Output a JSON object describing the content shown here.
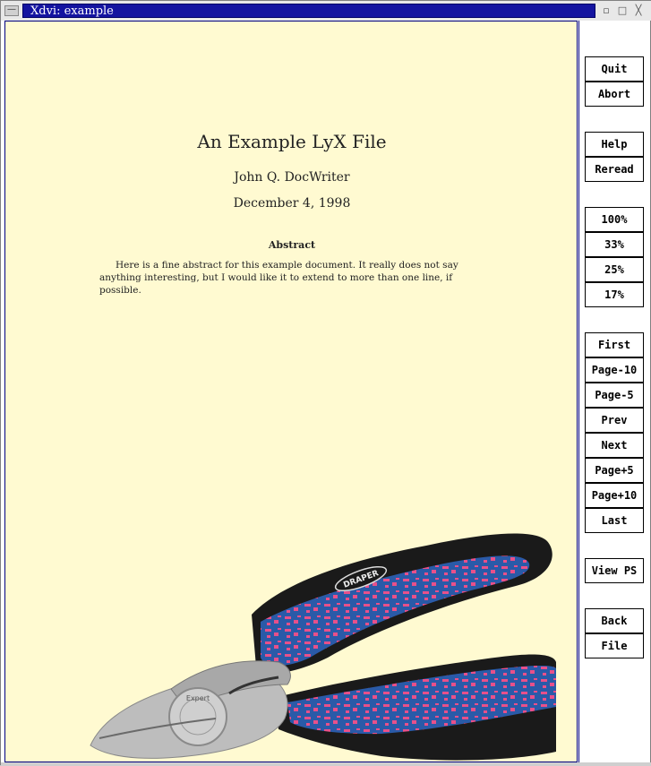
{
  "window": {
    "title": "Xdvi:  example",
    "menu_glyph": "—",
    "minimize_glyph": "▫",
    "maximize_glyph": "□",
    "close_glyph": "╳"
  },
  "document": {
    "title": "An Example LyX File",
    "author": "John Q. DocWriter",
    "date": "December 4, 1998",
    "abstract_heading": "Abstract",
    "abstract_text": "Here is a fine abstract for this example document. It really does not say anything interesting, but I would like it to extend to more than one line, if possible.",
    "image_brand": "DRAPER",
    "image_jaw_text": "Expert"
  },
  "buttons": {
    "quit": "Quit",
    "abort": "Abort",
    "help": "Help",
    "reread": "Reread",
    "zoom_100": "100%",
    "zoom_33": "33%",
    "zoom_25": "25%",
    "zoom_17": "17%",
    "first": "First",
    "page_minus_10": "Page-10",
    "page_minus_5": "Page-5",
    "prev": "Prev",
    "next": "Next",
    "page_plus_5": "Page+5",
    "page_plus_10": "Page+10",
    "last": "Last",
    "view_ps": "View PS",
    "back": "Back",
    "file": "File"
  },
  "colors": {
    "titlebar_active": "#1414a0",
    "page_background": "#fffad1",
    "handle_blue": "#2a5aa8",
    "handle_pink": "#e8508a",
    "handle_black": "#1a1a1a",
    "steel": "#bdbdbd"
  }
}
